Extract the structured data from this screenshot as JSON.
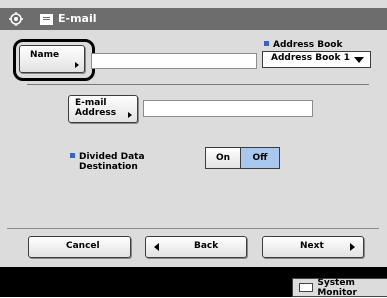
{
  "window": {
    "title": "E-mail"
  },
  "name_button": {
    "label": "Name"
  },
  "address_book": {
    "label": "Address Book",
    "selected": "Address Book 1"
  },
  "email_address": {
    "label_line1": "E-mail",
    "label_line2": "Address",
    "value": ""
  },
  "divided": {
    "label_line1": "Divided Data",
    "label_line2": "Destination",
    "on_label": "On",
    "off_label": "Off",
    "selected": "Off"
  },
  "nav": {
    "cancel": "Cancel",
    "back": "Back",
    "next": "Next"
  },
  "status": {
    "system_monitor": "System Monitor"
  },
  "colors": {
    "title_bar": "#6d6d6d",
    "bullet": "#3a63c9",
    "selected_toggle": "#a9c8ee"
  }
}
